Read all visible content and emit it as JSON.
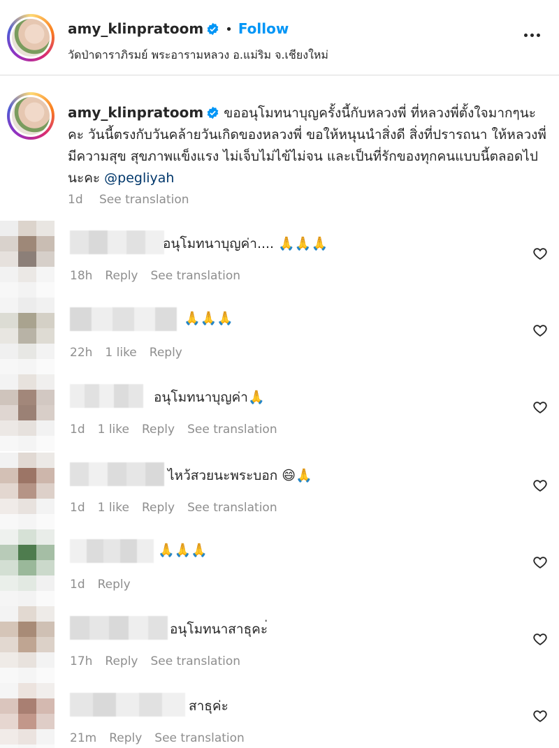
{
  "post": {
    "username": "amy_klinpratoom",
    "follow_label": "Follow",
    "separator": "•",
    "location": "วัดป่าดาราภิรมย์ พระอารามหลวง อ.แม่ริม จ.เชียงใหม่"
  },
  "caption": {
    "username": "amy_klinpratoom",
    "text": "ขออนุโมทนาบุญครั้งนี้กับหลวงพี่ ที่หลวงพี่ตั้งใจมากๆนะคะ วันนี้ตรงกับวันคล้ายวันเกิดของหลวงพี่ ขอให้หนุนนำสิ่งดี สิ่งที่ปรารถนา ให้หลวงพี่มีความสุข สุขภาพแข็งแรง ไม่เจ็บไม่ไข้ไม่จน และเป็นที่รักของทุกคนแบบนี้ตลอดไปนะคะ",
    "mention": "@pegliyah",
    "time": "1d",
    "see_translation": "See translation"
  },
  "comments": [
    {
      "text": "อนุโมทนาบุญค่า.... 🙏🙏🙏",
      "time": "18h",
      "likes": "",
      "reply": "Reply",
      "see_translation": "See translation"
    },
    {
      "text": "🙏🙏🙏",
      "time": "22h",
      "likes": "1 like",
      "reply": "Reply",
      "see_translation": ""
    },
    {
      "text": "อนุโมทนาบุญค่า🙏",
      "time": "1d",
      "likes": "1 like",
      "reply": "Reply",
      "see_translation": "See translation"
    },
    {
      "text": "ไหว้สวยนะพระบอก 😄🙏",
      "time": "1d",
      "likes": "1 like",
      "reply": "Reply",
      "see_translation": "See translation"
    },
    {
      "text": "🙏🙏🙏",
      "time": "1d",
      "likes": "",
      "reply": "Reply",
      "see_translation": ""
    },
    {
      "text": "อนุโมทนาสาธุคะ่",
      "time": "17h",
      "likes": "",
      "reply": "Reply",
      "see_translation": "See translation"
    },
    {
      "text": "สาธุค่ะ",
      "time": "21m",
      "likes": "",
      "reply": "Reply",
      "see_translation": "See translation"
    }
  ],
  "colors": {
    "follow": "#0095f6",
    "verified": "#0095f6",
    "meta": "#8e8e8e",
    "mention": "#00376b"
  },
  "icons": {
    "verified": "verified-badge-icon",
    "more": "more-options-icon",
    "heart": "heart-outline-icon"
  }
}
